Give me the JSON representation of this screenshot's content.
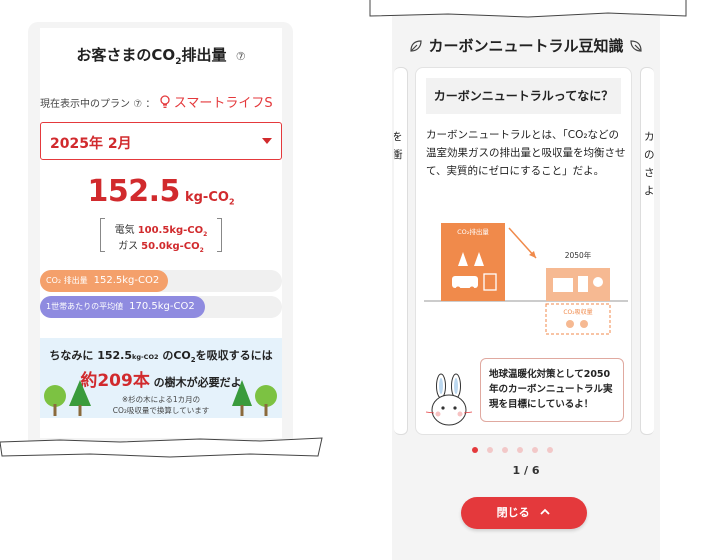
{
  "left": {
    "title_pre": "お客さまのCO",
    "title_sub": "2",
    "title_post": "排出量",
    "help_glyph": "⑦",
    "plan_label": "現在表示中のプラン",
    "plan_help_glyph": "⑦",
    "plan_colon": "：",
    "plan_name": "スマートライフS",
    "month_select": "2025年 2月",
    "total_value": "152.5",
    "total_unit": "kg-CO",
    "total_unit_sub": "2",
    "breakdown": [
      {
        "label": "電気",
        "value": "100.5kg-CO",
        "sub": "2"
      },
      {
        "label": "ガス",
        "value": "50.0kg-CO",
        "sub": "2"
      }
    ],
    "bars": [
      {
        "label": "CO₂ 排出量",
        "value": "152.5kg-CO2",
        "fill_fraction": 0.53
      },
      {
        "label": "1世帯あたりの平均値",
        "value": "170.5kg-CO2",
        "fill_fraction": 0.68
      }
    ],
    "trees": {
      "line1_pre": "ちなみに ",
      "line1_value": "152.5",
      "line1_unit": "kg-CO2",
      "line1_mid": " のCO",
      "line1_sub": "2",
      "line1_post": "を吸収するには",
      "line2_big": "約209本",
      "line2_post": " の樹木が必要だよ",
      "note1": "※杉の木による1カ月の",
      "note2": "CO₂吸収量で換算しています"
    }
  },
  "right": {
    "title": "カーボンニュートラル豆知識",
    "slide_heading": "カーボンニュートラルってなに？",
    "slide_text": "カーボンニュートラルとは、「CO₂などの温室効果ガスの排出量と吸収量を均衡させて、実質的にゼロにすること」だよ。",
    "illus_emission_label": "CO₂排出量",
    "illus_year": "2050年",
    "illus_absorb_label": "CO₂吸収量",
    "bubble_text": "地球温暖化対策として2050年のカーボンニュートラル実現を目標にしているよ！",
    "pager": "1 / 6",
    "dots_total": 6,
    "dots_active_index": 0,
    "close_label": "閉じる",
    "close_icon": "chevron-up-icon",
    "side_left_text": [
      "を",
      "衝"
    ],
    "side_right_text": [
      "カ",
      "の",
      "さ",
      "よ"
    ],
    "colors": {
      "accent": "#e4393c",
      "orange": "#f4a06b",
      "purple": "#8f8be0",
      "illus_orange": "#f08a4b"
    }
  }
}
